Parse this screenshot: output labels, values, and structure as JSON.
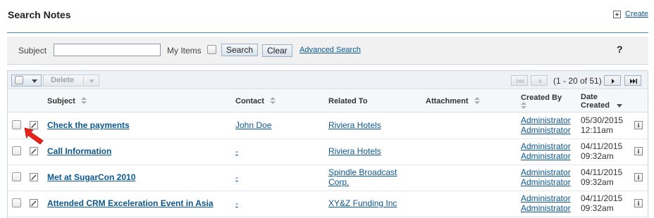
{
  "header": {
    "title": "Search Notes",
    "create_label": "Create"
  },
  "search": {
    "subject_label": "Subject",
    "subject_value": "",
    "my_items_label": "My Items",
    "search_button": "Search",
    "clear_button": "Clear",
    "advanced_link": "Advanced Search",
    "help_label": "?"
  },
  "toolbar": {
    "delete_label": "Delete",
    "pagination": "(1 - 20 of 51)"
  },
  "columns": {
    "subject": "Subject",
    "contact": "Contact",
    "related_to": "Related To",
    "attachment": "Attachment",
    "created_by": "Created By",
    "date_created_1": "Date",
    "date_created_2": "Created"
  },
  "rows": [
    {
      "subject": "Check the payments",
      "contact": "John Doe",
      "related_1": "Riviera Hotels",
      "related_2": "",
      "created_by_1": "Administrator",
      "created_by_2": "Administrator",
      "date": "05/30/2015",
      "time": "12:11am"
    },
    {
      "subject": "Call Information",
      "contact": "-",
      "related_1": "Riviera Hotels",
      "related_2": "",
      "created_by_1": "Administrator",
      "created_by_2": "Administrator",
      "date": "04/11/2015",
      "time": "09:32am"
    },
    {
      "subject": "Met at SugarCon 2010",
      "contact": "-",
      "related_1": "Spindle Broadcast",
      "related_2": "Corp.",
      "created_by_1": "Administrator",
      "created_by_2": "Administrator",
      "date": "04/11/2015",
      "time": "09:32am"
    },
    {
      "subject": "Attended CRM Exceleration Event in Asia",
      "contact": "-",
      "related_1": "XY&Z Funding Inc",
      "related_2": "",
      "created_by_1": "Administrator",
      "created_by_2": "Administrator",
      "date": "04/11/2015",
      "time": "09:32am"
    }
  ],
  "colors": {
    "link": "#0b578f",
    "accent_rule": "#4d8cc7",
    "pointer_arrow": "#e8231c"
  },
  "icons": [
    "create-plus-icon",
    "edit-pencil-icon",
    "info-icon",
    "sort-icon",
    "pointer-arrow-icon"
  ]
}
